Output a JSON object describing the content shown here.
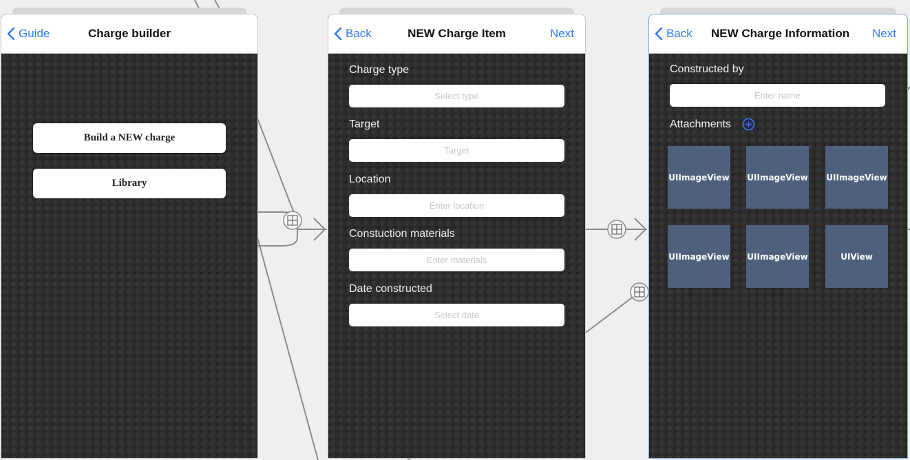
{
  "scene1": {
    "nav": {
      "back_label": "Guide",
      "title": "Charge builder"
    },
    "buttons": {
      "build_new": "Build a NEW charge",
      "library": "Library"
    }
  },
  "scene2": {
    "nav": {
      "back_label": "Back",
      "title": "NEW Charge Item",
      "next_label": "Next"
    },
    "fields": [
      {
        "label": "Charge type",
        "placeholder": "Select type"
      },
      {
        "label": "Target",
        "placeholder": "Target"
      },
      {
        "label": "Location",
        "placeholder": "Enter location"
      },
      {
        "label": "Constuction materials",
        "placeholder": "Enter materials"
      },
      {
        "label": "Date constructed",
        "placeholder": "Select date"
      }
    ]
  },
  "scene3": {
    "nav": {
      "back_label": "Back",
      "title": "NEW Charge Information",
      "next_label": "Next"
    },
    "constructed_by": {
      "label": "Constructed by",
      "placeholder": "Enter name"
    },
    "attachments_label": "Attachments",
    "tiles": [
      "UIImageView",
      "UIImageView",
      "UIImageView",
      "UIImageView",
      "UIImageView",
      "UIView"
    ]
  },
  "icons": [
    "chevron-left-icon",
    "add-circle-icon",
    "segue-icon"
  ],
  "colors": {
    "accent": "#2f7cf6",
    "tile": "#4e607c",
    "screen_bg": "#2b2b2b",
    "canvas": "#efefef"
  }
}
